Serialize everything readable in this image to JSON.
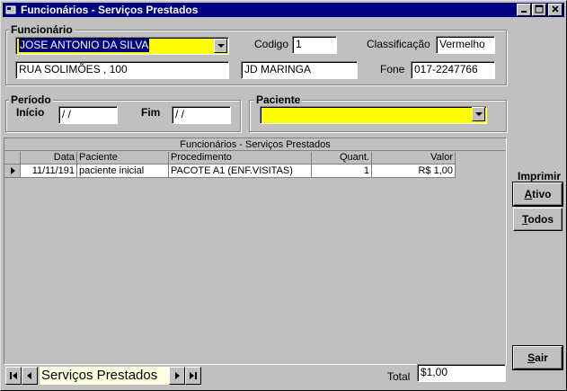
{
  "window": {
    "title": "Funcionários - Serviços Prestados",
    "controls": [
      "_",
      "□",
      "×"
    ]
  },
  "funcionario": {
    "group_label": "Funcionário",
    "name": "JOSE ANTONIO DA SILVA",
    "codigo_label": "Codigo",
    "codigo": "1",
    "classificacao_label": "Classificação",
    "classificacao": "Vermelho",
    "endereco": "RUA SOLIMÕES , 100",
    "bairro": "JD MARINGA",
    "fone_label": "Fone",
    "fone": "017-2247766"
  },
  "periodo": {
    "group_label": "Período",
    "inicio_label": "Início",
    "inicio": " / /",
    "fim_label": "Fim",
    "fim": " / /"
  },
  "paciente": {
    "group_label": "Paciente",
    "value": ""
  },
  "grid": {
    "caption": "Funcionários - Serviços Prestados",
    "columns": [
      "Data",
      "Paciente",
      "Procedimento",
      "Quant.",
      "Valor"
    ],
    "rows": [
      [
        "11/11/191",
        "paciente inicial",
        "PACOTE A1 (ENF.VISITAS)",
        "1",
        "R$ 1,00"
      ]
    ]
  },
  "imprimir": {
    "label": "Imprimir",
    "ativo_first": "A",
    "ativo_rest": "tivo",
    "todos_first": "T",
    "todos_rest": "odos"
  },
  "sair": {
    "first": "S",
    "rest": "air"
  },
  "navigator": {
    "caption": "Serviços Prestados"
  },
  "total": {
    "label": "Total",
    "value": "$1,00"
  }
}
